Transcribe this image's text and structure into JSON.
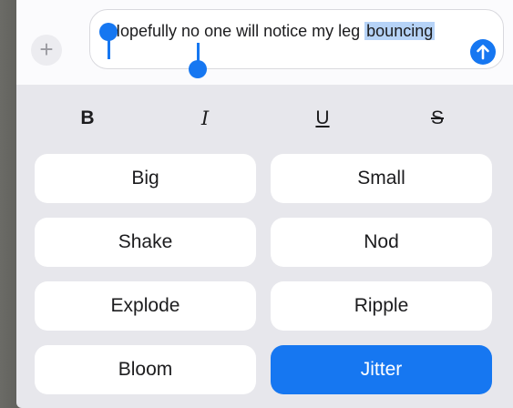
{
  "compose": {
    "text_before": "Hopefully no one will notice my leg ",
    "text_selected": "bouncing",
    "plus_icon": "+"
  },
  "formatting": {
    "bold": "B",
    "italic": "I",
    "underline": "U",
    "strikethrough": "S"
  },
  "effects": [
    {
      "label": "Big",
      "selected": false
    },
    {
      "label": "Small",
      "selected": false
    },
    {
      "label": "Shake",
      "selected": false
    },
    {
      "label": "Nod",
      "selected": false
    },
    {
      "label": "Explode",
      "selected": false
    },
    {
      "label": "Ripple",
      "selected": false
    },
    {
      "label": "Bloom",
      "selected": false
    },
    {
      "label": "Jitter",
      "selected": true
    }
  ],
  "colors": {
    "accent": "#1677f1",
    "selection": "#b6d3f7",
    "panel": "#e7e7ec"
  }
}
